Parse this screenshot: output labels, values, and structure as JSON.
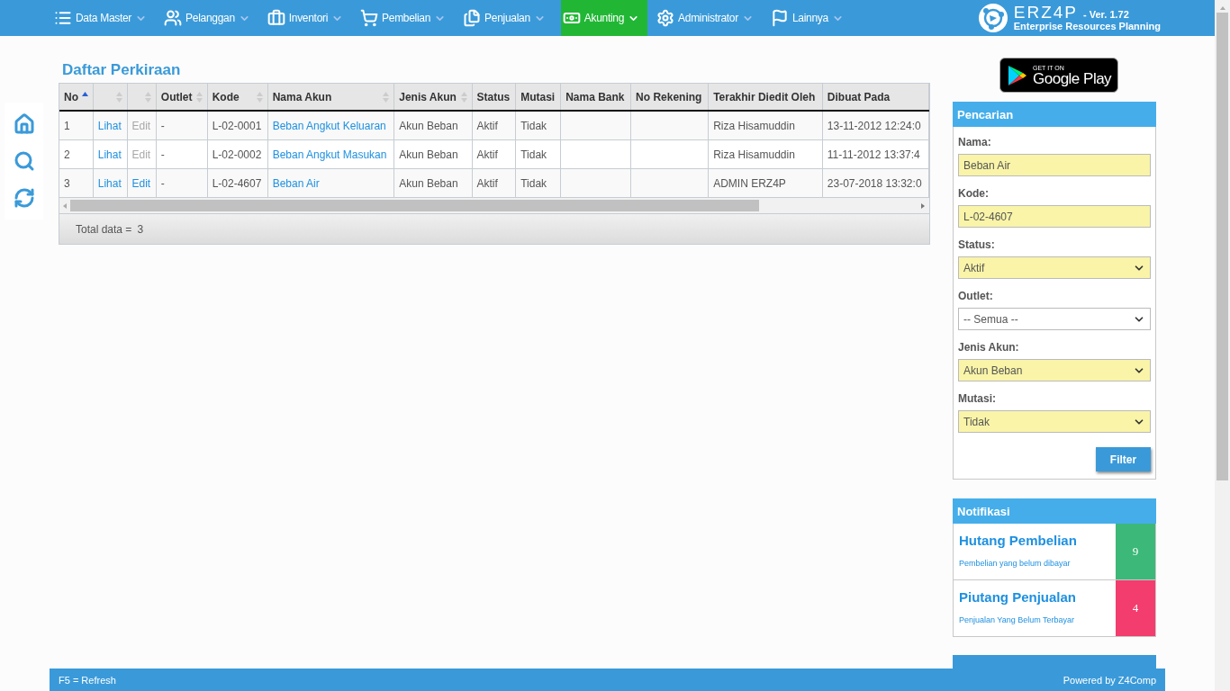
{
  "nav": {
    "items": [
      {
        "label": "Data Master",
        "selected": false
      },
      {
        "label": "Pelanggan",
        "selected": false
      },
      {
        "label": "Inventori",
        "selected": false
      },
      {
        "label": "Pembelian",
        "selected": false
      },
      {
        "label": "Penjualan",
        "selected": false
      },
      {
        "label": "Akunting",
        "selected": true
      },
      {
        "label": "Administrator",
        "selected": false
      },
      {
        "label": "Lainnya",
        "selected": false
      }
    ],
    "logo": {
      "name": "ERZ4P",
      "version": "- Ver. 1.72",
      "tagline": "Enterprise Resources Planning"
    }
  },
  "page_title": "Daftar Perkiraan",
  "table": {
    "columns": [
      {
        "label": "No",
        "sortable": true,
        "sorted": true
      },
      {
        "sortable": true,
        "sorted": false
      },
      {
        "sortable": true,
        "sorted": false
      },
      {
        "label": "Outlet",
        "sortable": true,
        "sorted": false
      },
      {
        "label": "Kode",
        "sortable": true,
        "sorted": false
      },
      {
        "label": "Nama Akun",
        "sortable": true,
        "sorted": false
      },
      {
        "label": "Jenis Akun",
        "sortable": true,
        "sorted": false
      },
      {
        "label": "Status",
        "sortable": false,
        "sorted": false
      },
      {
        "label": "Mutasi",
        "sortable": false,
        "sorted": false
      },
      {
        "label": "Nama Bank",
        "sortable": false,
        "sorted": false
      },
      {
        "label": "No Rekening",
        "sortable": false,
        "sorted": false
      },
      {
        "label": "Terakhir Diedit Oleh",
        "sortable": false,
        "sorted": false
      },
      {
        "label": "Dibuat Pada",
        "sortable": false,
        "sorted": false
      }
    ],
    "rows": [
      {
        "no": "1",
        "view": "Lihat",
        "edit": {
          "label": "Edit",
          "disabled": true
        },
        "outlet": "-",
        "kode": "L-02-0001",
        "nama": "Beban Angkut Keluaran",
        "jenis": "Akun Beban",
        "status": "Aktif",
        "mutasi": "Tidak",
        "editor": "Riza Hisamuddin",
        "created": "13-11-2012 12:24:0"
      },
      {
        "no": "2",
        "view": "Lihat",
        "edit": {
          "label": "Edit",
          "disabled": true
        },
        "outlet": "-",
        "kode": "L-02-0002",
        "nama": "Beban Angkut Masukan",
        "jenis": "Akun Beban",
        "status": "Aktif",
        "mutasi": "Tidak",
        "editor": "Riza Hisamuddin",
        "created": "11-11-2012 13:37:4"
      },
      {
        "no": "3",
        "view": "Lihat",
        "edit": {
          "label": "Edit",
          "disabled": false
        },
        "outlet": "-",
        "kode": "L-02-4607",
        "nama": "Beban Air",
        "jenis": "Akun Beban",
        "status": "Aktif",
        "mutasi": "Tidak",
        "editor": "ADMIN ERZ4P",
        "created": "23-07-2018 13:32:0"
      }
    ],
    "total_label": "Total data =",
    "total": "3"
  },
  "store_badge": {
    "top": "GET IT ON",
    "bottom": "Google Play"
  },
  "search_panel": {
    "title": "Pencarian",
    "fields": [
      {
        "label": "Nama:",
        "kind": "input",
        "value": "Beban Air",
        "filled": true
      },
      {
        "label": "Kode:",
        "kind": "input",
        "value": "L-02-4607",
        "filled": true
      },
      {
        "label": "Status:",
        "kind": "select",
        "value": "Aktif",
        "filled": true
      },
      {
        "label": "Outlet:",
        "kind": "select",
        "value": "-- Semua --",
        "filled": false
      },
      {
        "label": "Jenis Akun:",
        "kind": "select",
        "value": "Akun Beban",
        "filled": true
      },
      {
        "label": "Mutasi:",
        "kind": "select",
        "value": "Tidak",
        "filled": true
      }
    ],
    "button": "Filter"
  },
  "notifications": {
    "title": "Notifikasi",
    "items": [
      {
        "title": "Hutang Pembelian",
        "subtitle": "Pembelian yang belum dibayar",
        "count": "9",
        "color": "#3cb878"
      },
      {
        "title": "Piutang Penjualan",
        "subtitle": "Penjualan Yang Belum Terbayar",
        "count": "4",
        "color": "#f23d6e"
      }
    ]
  },
  "footer": {
    "left": "F5 = Refresh",
    "right": "Powered by Z4Comp"
  }
}
